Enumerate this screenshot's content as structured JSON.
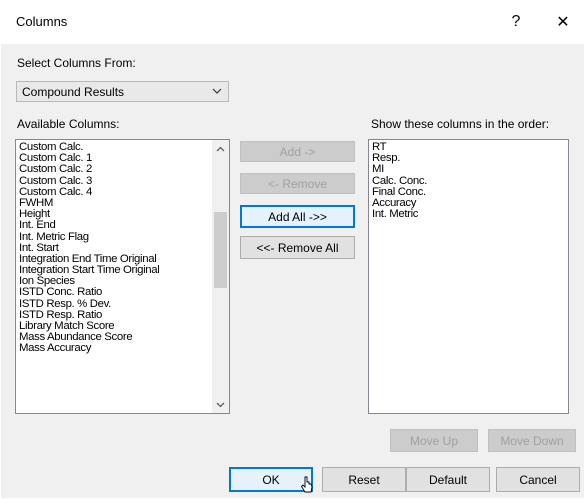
{
  "window": {
    "title": "Columns",
    "help_label": "?",
    "close_label": "✕"
  },
  "select_from": {
    "label": "Select Columns From:",
    "value": "Compound Results"
  },
  "available": {
    "label": "Available Columns:",
    "items": [
      "Custom Calc.",
      "Custom Calc. 1",
      "Custom Calc. 2",
      "Custom Calc. 3",
      "Custom Calc. 4",
      "FWHM",
      "Height",
      "Int. End",
      "Int. Metric Flag",
      "Int. Start",
      "Integration End Time Original",
      "Integration Start Time Original",
      "Ion Species",
      "ISTD Conc. Ratio",
      "ISTD Resp. % Dev.",
      "ISTD Resp. Ratio",
      "Library Match Score",
      "Mass Abundance Score",
      "Mass Accuracy"
    ]
  },
  "shown": {
    "label": "Show these columns in the order:",
    "items": [
      "RT",
      "Resp.",
      "MI",
      "Calc. Conc.",
      "Final Conc.",
      "Accuracy",
      "Int. Metric"
    ]
  },
  "buttons": {
    "add": "Add ->",
    "remove": "<- Remove",
    "add_all": "Add All ->>",
    "remove_all": "<<- Remove All",
    "move_up": "Move Up",
    "move_down": "Move Down",
    "ok": "OK",
    "reset": "Reset",
    "default": "Default",
    "cancel": "Cancel"
  }
}
